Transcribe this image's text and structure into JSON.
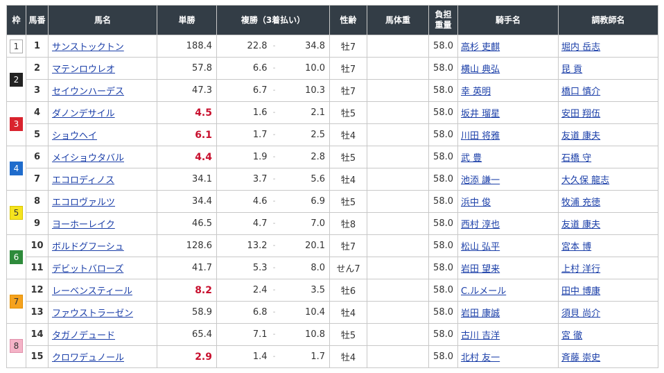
{
  "headers": {
    "waku": "枠",
    "umaban": "馬番",
    "horse": "馬名",
    "win": "単勝",
    "place": "複勝（3着払い）",
    "sexage": "性齢",
    "body_weight": "馬体重",
    "burden_line1": "負担",
    "burden_line2": "重量",
    "jockey": "騎手名",
    "trainer": "調教師名"
  },
  "place_separator": "-",
  "waku_colors": {
    "1": "#ffffff",
    "2": "#222222",
    "3": "#d9232e",
    "4": "#1f6ccc",
    "5": "#f5e31f",
    "6": "#2e8b3b",
    "7": "#f5a21e",
    "8": "#f4b3c7"
  },
  "rows": [
    {
      "waku": "1",
      "umaban": "1",
      "horse": "サンストックトン",
      "win": "188.4",
      "popular": false,
      "place_min": "22.8",
      "place_max": "34.8",
      "sexage": "牡7",
      "body_weight": "",
      "burden": "58.0",
      "jockey": "高杉 吏麒",
      "trainer": "堀内 岳志"
    },
    {
      "waku": "2",
      "umaban": "2",
      "horse": "マテンロウレオ",
      "win": "57.8",
      "popular": false,
      "place_min": "6.6",
      "place_max": "10.0",
      "sexage": "牡7",
      "body_weight": "",
      "burden": "58.0",
      "jockey": "横山 典弘",
      "trainer": "昆 貢"
    },
    {
      "waku": "2",
      "umaban": "3",
      "horse": "セイウンハーデス",
      "win": "47.3",
      "popular": false,
      "place_min": "6.7",
      "place_max": "10.3",
      "sexage": "牡7",
      "body_weight": "",
      "burden": "58.0",
      "jockey": "幸 英明",
      "trainer": "橋口 慎介"
    },
    {
      "waku": "3",
      "umaban": "4",
      "horse": "ダノンデサイル",
      "win": "4.5",
      "popular": true,
      "place_min": "1.6",
      "place_max": "2.1",
      "sexage": "牡5",
      "body_weight": "",
      "burden": "58.0",
      "jockey": "坂井 瑠星",
      "trainer": "安田 翔伍"
    },
    {
      "waku": "3",
      "umaban": "5",
      "horse": "ショウヘイ",
      "win": "6.1",
      "popular": true,
      "place_min": "1.7",
      "place_max": "2.5",
      "sexage": "牡4",
      "body_weight": "",
      "burden": "58.0",
      "jockey": "川田 将雅",
      "trainer": "友道 康夫"
    },
    {
      "waku": "4",
      "umaban": "6",
      "horse": "メイショウタバル",
      "win": "4.4",
      "popular": true,
      "place_min": "1.9",
      "place_max": "2.8",
      "sexage": "牡5",
      "body_weight": "",
      "burden": "58.0",
      "jockey": "武 豊",
      "trainer": "石橋 守"
    },
    {
      "waku": "4",
      "umaban": "7",
      "horse": "エコロディノス",
      "win": "34.1",
      "popular": false,
      "place_min": "3.7",
      "place_max": "5.6",
      "sexage": "牡4",
      "body_weight": "",
      "burden": "58.0",
      "jockey": "池添 謙一",
      "trainer": "大久保 龍志"
    },
    {
      "waku": "5",
      "umaban": "8",
      "horse": "エコロヴァルツ",
      "win": "34.4",
      "popular": false,
      "place_min": "4.6",
      "place_max": "6.9",
      "sexage": "牡5",
      "body_weight": "",
      "burden": "58.0",
      "jockey": "浜中 俊",
      "trainer": "牧浦 充徳"
    },
    {
      "waku": "5",
      "umaban": "9",
      "horse": "ヨーホーレイク",
      "win": "46.5",
      "popular": false,
      "place_min": "4.7",
      "place_max": "7.0",
      "sexage": "牡8",
      "body_weight": "",
      "burden": "58.0",
      "jockey": "西村 淳也",
      "trainer": "友道 康夫"
    },
    {
      "waku": "6",
      "umaban": "10",
      "horse": "ボルドグフーシュ",
      "win": "128.6",
      "popular": false,
      "place_min": "13.2",
      "place_max": "20.1",
      "sexage": "牡7",
      "body_weight": "",
      "burden": "58.0",
      "jockey": "松山 弘平",
      "trainer": "宮本 博"
    },
    {
      "waku": "6",
      "umaban": "11",
      "horse": "デビットバローズ",
      "win": "41.7",
      "popular": false,
      "place_min": "5.3",
      "place_max": "8.0",
      "sexage": "せん7",
      "body_weight": "",
      "burden": "58.0",
      "jockey": "岩田 望来",
      "trainer": "上村 洋行"
    },
    {
      "waku": "7",
      "umaban": "12",
      "horse": "レーベンスティール",
      "win": "8.2",
      "popular": true,
      "place_min": "2.4",
      "place_max": "3.5",
      "sexage": "牡6",
      "body_weight": "",
      "burden": "58.0",
      "jockey": "C.ルメール",
      "trainer": "田中 博康"
    },
    {
      "waku": "7",
      "umaban": "13",
      "horse": "ファウストラーゼン",
      "win": "58.9",
      "popular": false,
      "place_min": "6.8",
      "place_max": "10.4",
      "sexage": "牡4",
      "body_weight": "",
      "burden": "58.0",
      "jockey": "岩田 康誠",
      "trainer": "須貝 尚介"
    },
    {
      "waku": "8",
      "umaban": "14",
      "horse": "タガノデュード",
      "win": "65.4",
      "popular": false,
      "place_min": "7.1",
      "place_max": "10.8",
      "sexage": "牡5",
      "body_weight": "",
      "burden": "58.0",
      "jockey": "古川 吉洋",
      "trainer": "宮 徹"
    },
    {
      "waku": "8",
      "umaban": "15",
      "horse": "クロワデュノール",
      "win": "2.9",
      "popular": true,
      "place_min": "1.4",
      "place_max": "1.7",
      "sexage": "牡4",
      "body_weight": "",
      "burden": "58.0",
      "jockey": "北村 友一",
      "trainer": "斉藤 崇史"
    }
  ]
}
